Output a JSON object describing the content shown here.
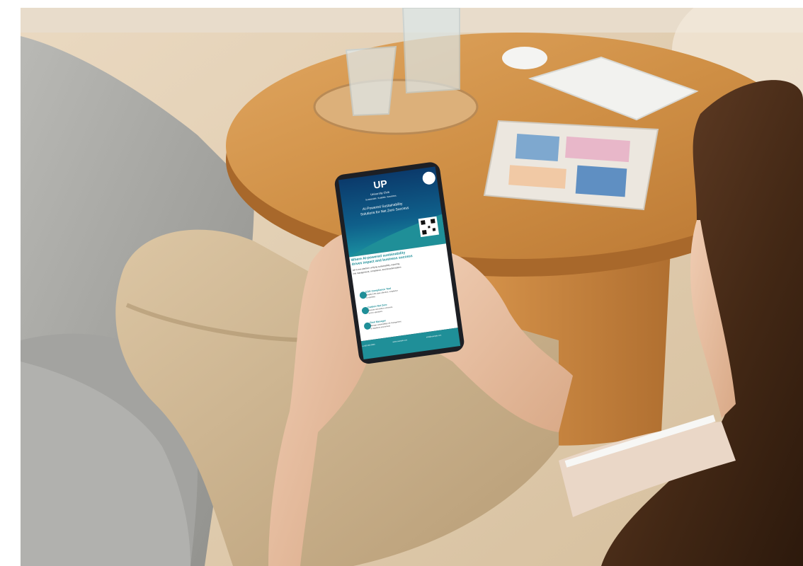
{
  "phone_screen": {
    "logo_text": "UP",
    "brand_line": "University Club",
    "tagline": "Sustainable. Scalable. Seamless.",
    "headline_1": "AI-Powered Sustainability",
    "headline_2": "Solutions for Net Zero Success",
    "section_title_1": "Where AI-powered sustainability",
    "section_title_2": "drives impact and business success",
    "body_1": "All-in-one platform unifying sustainability, reporting,",
    "body_2": "risk management, compliance, and decarbonization",
    "features": [
      {
        "title": "ESG Compliance Tool",
        "desc_1": "Simplify ESG data collection, compliance",
        "desc_2": "& reporting"
      },
      {
        "title": "Carbon Net Zero",
        "desc_1": "Measure and reduce emissions",
        "desc_2": "across operations"
      },
      {
        "title": "Risk Manager",
        "desc_1": "Manage sustainability risk management",
        "desc_2": "& regulatory assessment"
      }
    ],
    "footer_items": [
      "+1 000 000 0000",
      "www.example.com",
      "info@example.com"
    ]
  },
  "colors": {
    "teal": "#1f8f98",
    "navy": "#0b2d52",
    "wood": "#c98a3d",
    "sofa": "#a6a6a2",
    "pants": "#cdb491",
    "hair": "#4c2e1c",
    "skin": "#e8c1a6"
  }
}
